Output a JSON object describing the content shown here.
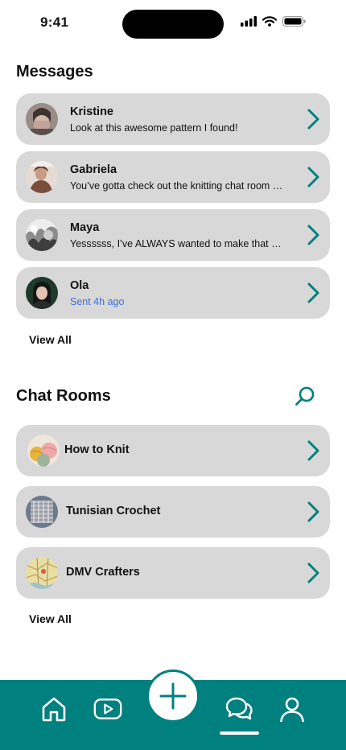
{
  "status_bar": {
    "time": "9:41"
  },
  "messages": {
    "title": "Messages",
    "items": [
      {
        "name": "Kristine",
        "preview": "Look at this awesome pattern I found!",
        "avatar_icon": "avatar-kristine"
      },
      {
        "name": "Gabriela",
        "preview": "You’ve gotta check out the knitting chat room …",
        "avatar_icon": "avatar-gabriela"
      },
      {
        "name": "Maya",
        "preview": "Yessssss, I’ve ALWAYS wanted to make that …",
        "avatar_icon": "avatar-maya"
      },
      {
        "name": "Ola",
        "preview": "Sent 4h ago",
        "avatar_icon": "avatar-ola"
      }
    ],
    "view_all_label": "View All"
  },
  "chat_rooms": {
    "title": "Chat Rooms",
    "items": [
      {
        "name": "How to Knit",
        "thumb_icon": "yarn-balls-thumbnail"
      },
      {
        "name": "Tunisian Crochet",
        "thumb_icon": "crochet-swatch-thumbnail"
      },
      {
        "name": "DMV Crafters",
        "thumb_icon": "map-thumbnail"
      }
    ],
    "view_all_label": "View All"
  },
  "colors": {
    "accent": "#00807e",
    "card": "#d8d8d8",
    "link": "#3a6fd8"
  },
  "bottom_nav": {
    "items": [
      "home-icon",
      "video-icon",
      "add-icon",
      "chat-icon",
      "profile-icon"
    ],
    "active": "chat-icon"
  }
}
